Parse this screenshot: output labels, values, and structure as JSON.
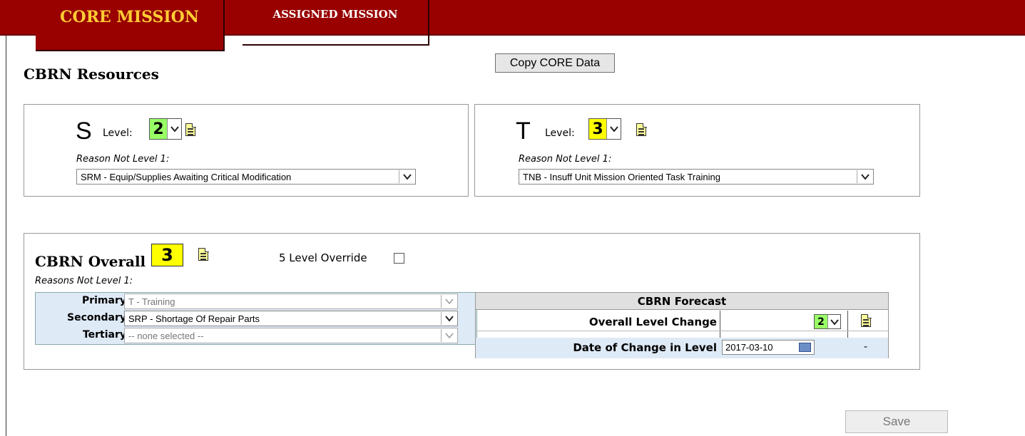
{
  "tabs": {
    "core": "CORE MISSION",
    "assigned": "ASSIGNED MISSION"
  },
  "copy_button": "Copy CORE Data",
  "section_title": "CBRN Resources",
  "s_panel": {
    "letter": "S",
    "level_label": "Level:",
    "level_value": "2",
    "level_color": "#99ff66",
    "reason_label": "Reason Not Level 1:",
    "reason_value": "SRM - Equip/Supplies Awaiting Critical Modification"
  },
  "t_panel": {
    "letter": "T",
    "level_label": "Level:",
    "level_value": "3",
    "level_color": "#ffff00",
    "reason_label": "Reason Not Level 1:",
    "reason_value": "TNB - Insuff Unit Mission Oriented Task Training"
  },
  "overall": {
    "title": "CBRN Overall",
    "value": "3",
    "value_color": "#ffff00",
    "override_label": "5 Level Override",
    "override_checked": false,
    "reasons_label": "Reasons Not Level 1:",
    "primary_label": "Primary",
    "primary_value": "T - Training",
    "secondary_label": "Secondary",
    "secondary_value": "SRP - Shortage Of Repair Parts",
    "tertiary_label": "Tertiary",
    "tertiary_value": "-- none selected --"
  },
  "forecast": {
    "title": "CBRN Forecast",
    "level_change_label": "Overall Level Change",
    "level_change_value": "2",
    "date_label": "Date of Change in Level",
    "date_value": "2017-03-10",
    "dash": "-"
  },
  "save_button": "Save",
  "colors": {
    "header_bg": "#990000",
    "core_tab_text": "#ffcc33",
    "label_cell_bg": "#dfeaf7"
  }
}
